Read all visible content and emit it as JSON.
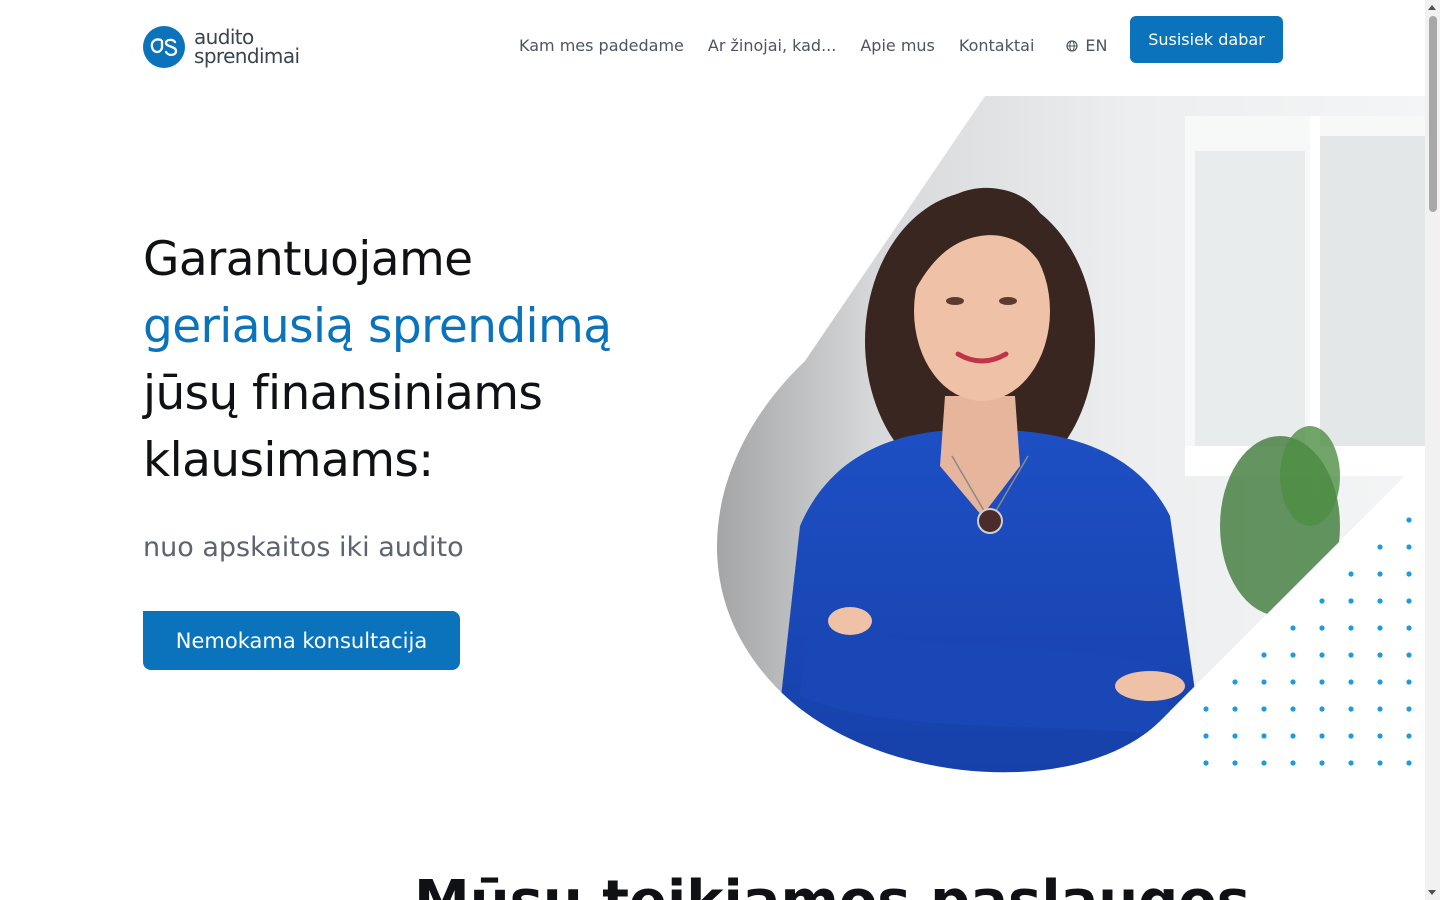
{
  "header": {
    "logo_line1": "audito",
    "logo_line2": "sprendimai",
    "logo_icon": "as-monogram-logo",
    "nav": [
      {
        "label": "Kam mes padedame"
      },
      {
        "label": "Ar žinojai, kad..."
      },
      {
        "label": "Apie mus"
      },
      {
        "label": "Kontaktai"
      }
    ],
    "lang_label": "EN",
    "lang_icon": "globe-icon",
    "cta_label": "Susisiek dabar"
  },
  "hero": {
    "title_line1": "Garantuojame",
    "title_accent": "geriausią sprendimą",
    "title_line3": "jūsų finansiniams",
    "title_line4": "klausimams:",
    "subtitle": "nuo apskaitos iki audito",
    "cta_label": "Nemokama konsultacija",
    "image": "woman-portrait-photo"
  },
  "next_section": {
    "title": "Mūsų teikiamos paslaugos"
  },
  "colors": {
    "brand": "#0a73bb",
    "dots": "#1e9be0",
    "text": "#0f1114",
    "muted": "#5b6470"
  }
}
